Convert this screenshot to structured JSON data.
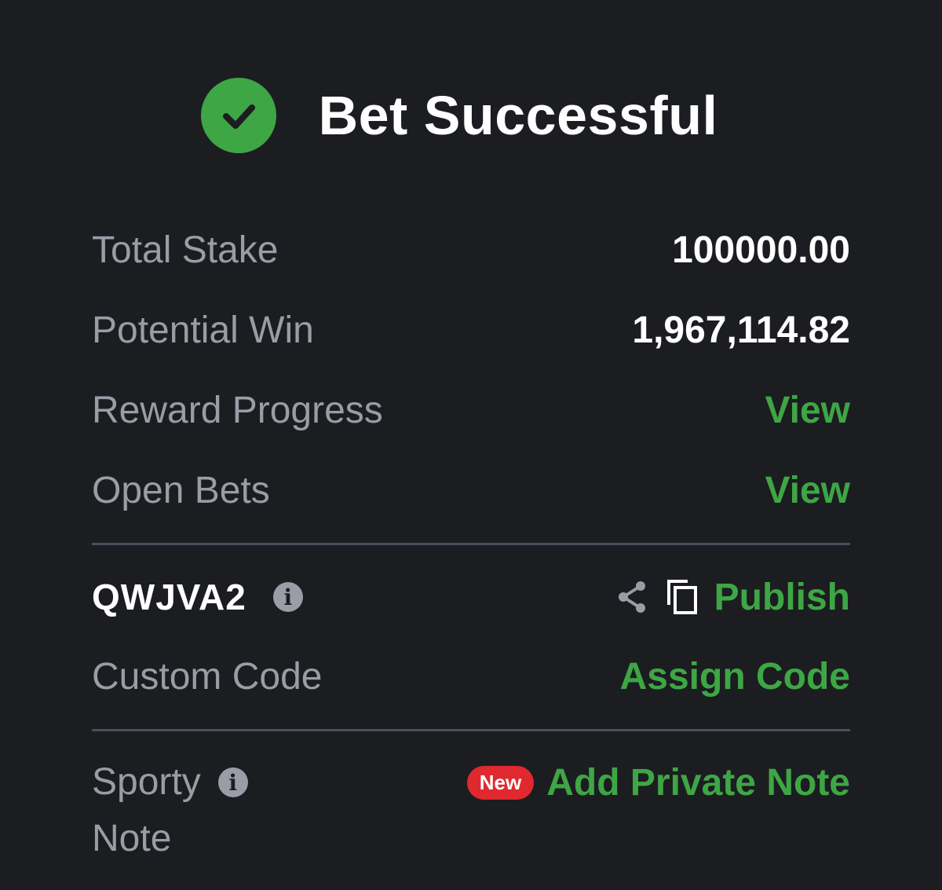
{
  "header": {
    "title": "Bet Successful",
    "status_color": "#3ea645",
    "icon": "check-circle-icon"
  },
  "summary": {
    "total_stake_label": "Total Stake",
    "total_stake_value": "100000.00",
    "potential_win_label": "Potential Win",
    "potential_win_value": "1,967,114.82",
    "reward_progress_label": "Reward Progress",
    "reward_progress_link": "View",
    "open_bets_label": "Open Bets",
    "open_bets_link": "View"
  },
  "booking": {
    "code": "QWJVA2",
    "info_icon": "info-icon",
    "share_icon": "share-icon",
    "copy_icon": "copy-icon",
    "publish_label": "Publish",
    "custom_code_label": "Custom Code",
    "assign_code_label": "Assign Code"
  },
  "note": {
    "label_line1": "Sporty",
    "label_line2": "Note",
    "badge": "New",
    "add_note_label": "Add Private Note",
    "badge_color": "#e0292f"
  },
  "colors": {
    "background": "#1c1d21",
    "accent": "#3ea645",
    "muted_text": "#9a9da6"
  }
}
